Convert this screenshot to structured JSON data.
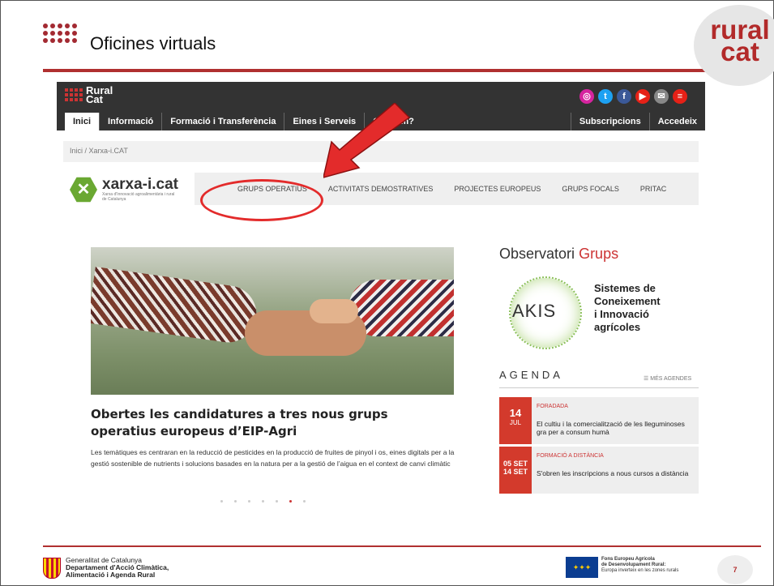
{
  "slide": {
    "title": "Oficines virtuals",
    "logo_line1": "rural",
    "logo_line2": "cat",
    "page_number": "7"
  },
  "site": {
    "logo_line1": "Rural",
    "logo_line2": "Cat",
    "nav": [
      "Inici",
      "Informació",
      "Formació i Transferència",
      "Eines i Serveis",
      "Qui som?"
    ],
    "nav_right": [
      "Subscripcions",
      "Accedeix"
    ],
    "breadcrumb": "Inici / Xarxa-i.CAT",
    "xarxa_name": "xarxa-i.cat",
    "xarxa_sub": "Xarxa d'Innovació agroalimentària i rural de Catalunya",
    "xarxa_menu": [
      "GRUPS OPERATIUS",
      "ACTIVITATS DEMOSTRATIVES",
      "PROJECTES EUROPEUS",
      "GRUPS FOCALS",
      "PRITAC"
    ],
    "news_title": "Obertes les candidatures a tres nous grups operatius europeus d’EIP-Agri",
    "news_body": "Les temàtiques es centraran en la reducció de pesticides en la producció de fruites de pinyol i os, eines digitals per a la gestió sostenible de nutrients i solucions basades en la natura per a la gestió de l’aigua en el context de canvi climàtic",
    "observatori": "Observatori",
    "observatori_grups": "Grups",
    "akis": "AKIS",
    "akis_text": [
      "Sistemes de",
      "Coneixement",
      "i Innovació",
      "agrícoles"
    ],
    "agenda_title": "AGENDA",
    "agenda_more": "MÉS AGENDES",
    "events": [
      {
        "day": "14",
        "month": "JUL",
        "category": "FORADADA",
        "title": "El cultiu i la comercialització de les lleguminoses gra per a consum humà"
      },
      {
        "day": "05 SET",
        "month": "14 SET",
        "category": "FORMACIÓ A DISTÀNCIA",
        "title": "S'obren les inscripcions a nous cursos a distància"
      }
    ]
  },
  "footer": {
    "gencat_line1": "Generalitat de Catalunya",
    "gencat_line2": "Departament d'Acció Climàtica,",
    "gencat_line3": "Alimentació i Agenda Rural",
    "feader_line1": "Fons Europeu Agrícola",
    "feader_line2": "de Desenvolupament Rural:",
    "feader_line3": "Europa inverteix en les zones rurals"
  },
  "colors": {
    "accent": "#b03030",
    "annotation": "#e32b2b",
    "xarxa_green": "#6aa832"
  },
  "slider": {
    "pages": 7,
    "active": 6
  }
}
